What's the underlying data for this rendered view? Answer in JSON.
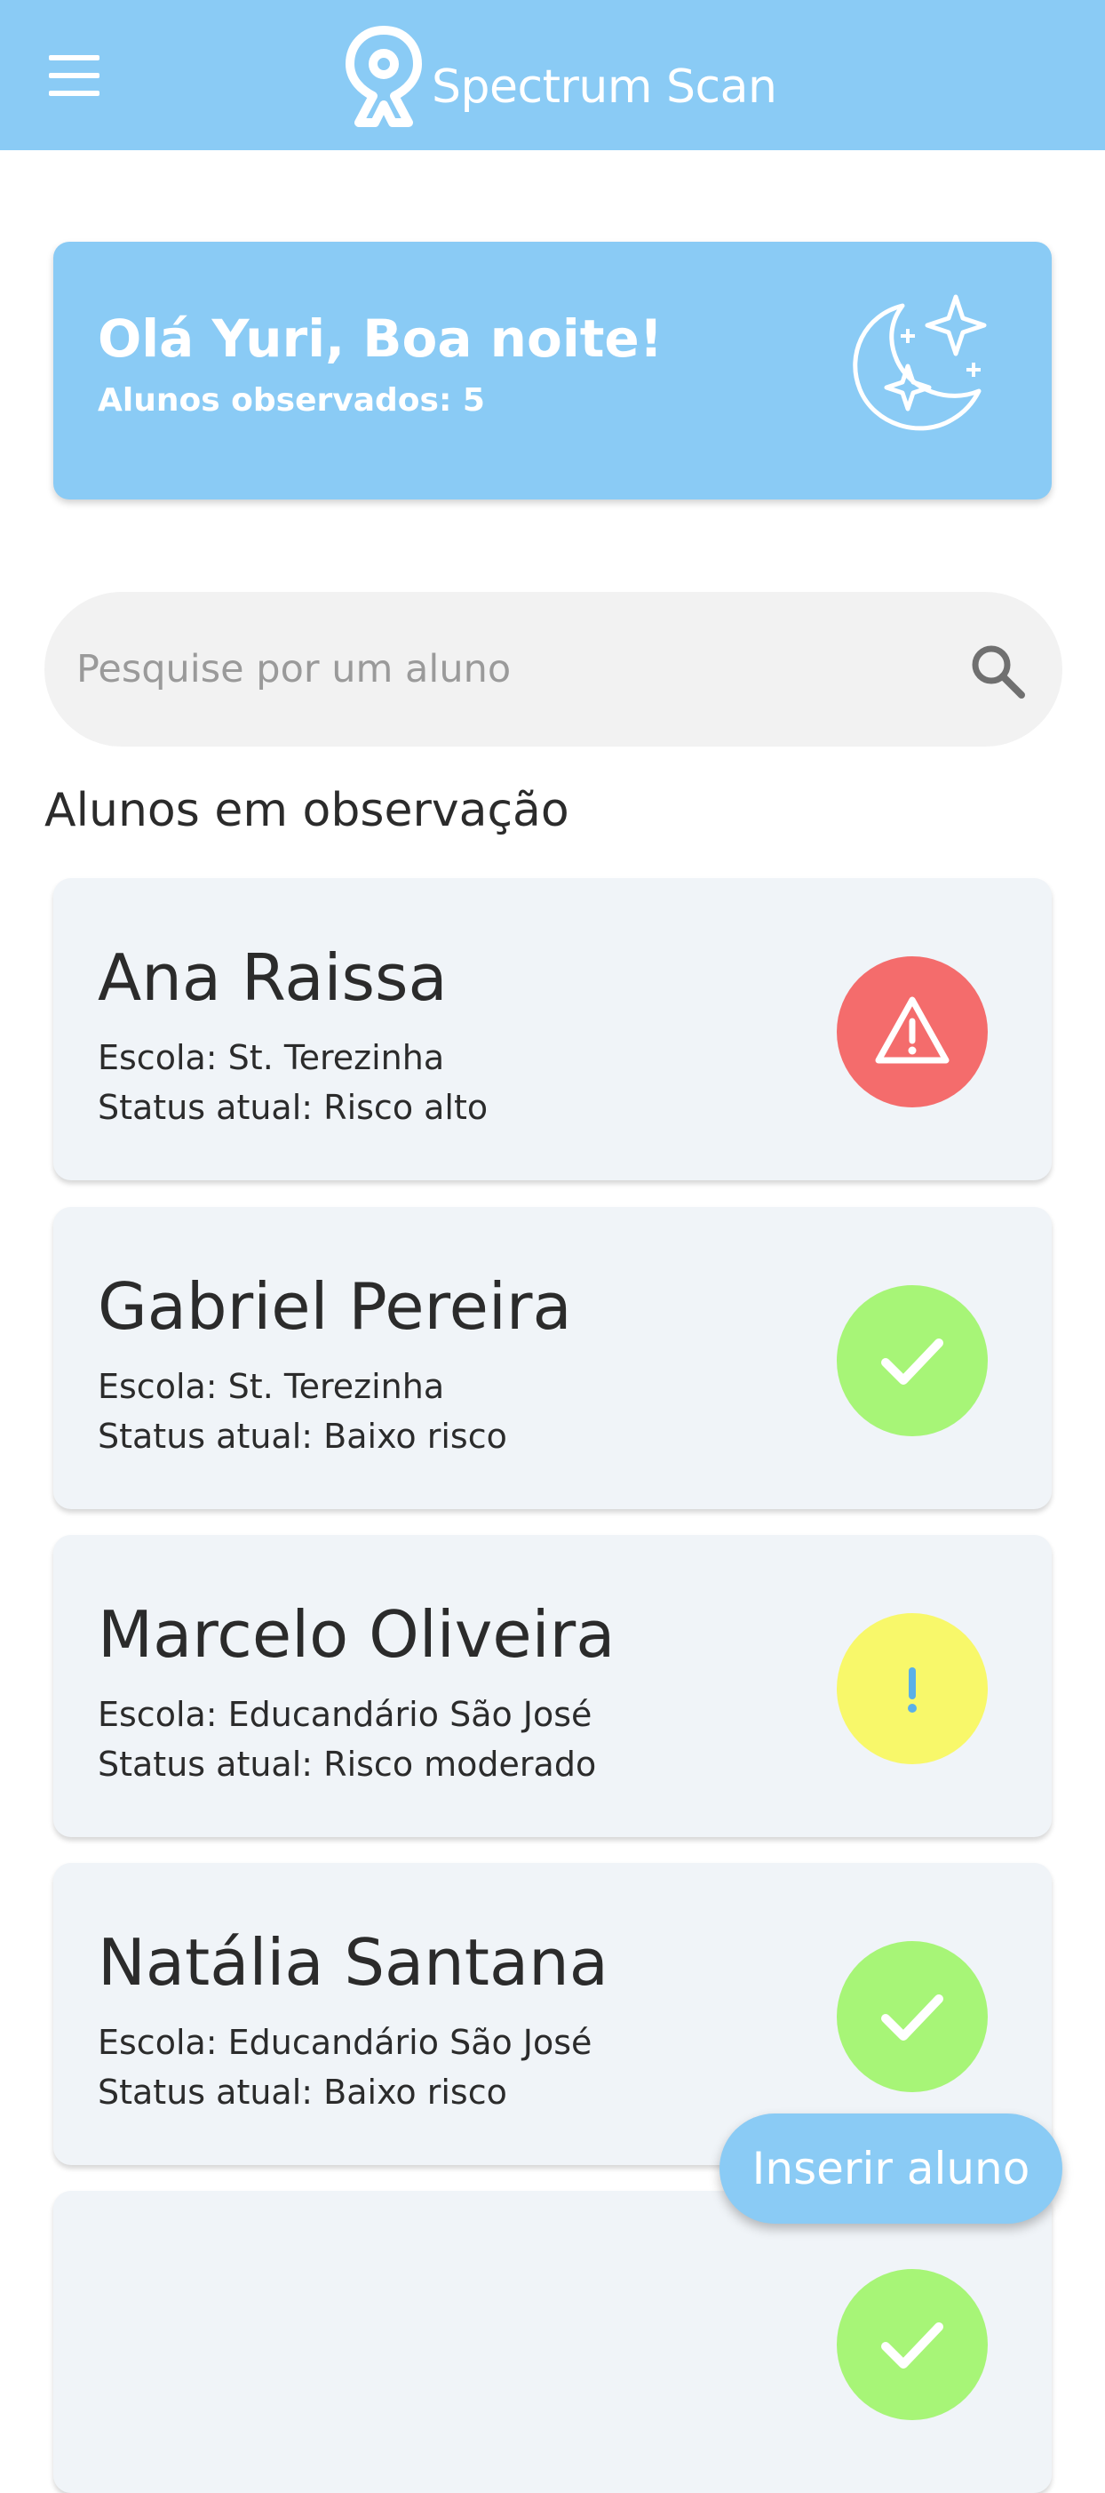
{
  "app": {
    "title": "Spectrum Scan",
    "accent_color": "#8acbf5",
    "menu_icon": "hamburger-menu-icon",
    "logo_icon": "ribbon-pin-icon"
  },
  "greeting": {
    "title": "Olá Yuri, Boa noite!",
    "subtitle": "Alunos observados: 5",
    "icon": "moon-stars-icon"
  },
  "search": {
    "placeholder": "Pesquise por um aluno",
    "value": "",
    "icon": "search-icon"
  },
  "section": {
    "title": "Alunos em observação"
  },
  "students": [
    {
      "name": "Ana Raissa",
      "school": "Escola: St. Terezinha",
      "status": "Status atual: Risco alto",
      "status_icon": "warning-icon",
      "status_color": "#f46c6c"
    },
    {
      "name": "Gabriel Pereira",
      "school": "Escola: St. Terezinha",
      "status": "Status atual: Baixo risco",
      "status_icon": "check-icon",
      "status_color": "#a7f577"
    },
    {
      "name": "Marcelo Oliveira",
      "school": "Escola: Educandário São José",
      "status": "Status atual: Risco moderado",
      "status_icon": "exclamation-icon",
      "status_color": "#f8f86a"
    },
    {
      "name": "Natália Santana",
      "school": "Escola: Educandário São José",
      "status": "Status atual: Baixo risco",
      "status_icon": "check-icon",
      "status_color": "#a7f577"
    },
    {
      "name": "",
      "school": "",
      "status": "",
      "status_icon": "check-icon",
      "status_color": "#a7f577"
    }
  ],
  "fab": {
    "label": "Inserir aluno"
  }
}
